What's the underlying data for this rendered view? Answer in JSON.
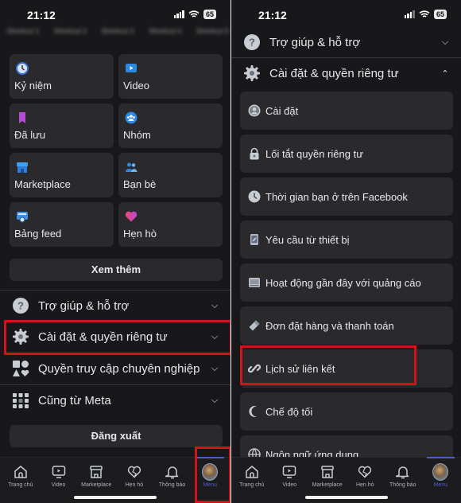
{
  "status_bar": {
    "time": "21:12",
    "battery": "65"
  },
  "left": {
    "blurred_shortcuts": [
      "Shortcut 1",
      "Shortcut 2",
      "Shortcut 3",
      "Shortcut 4",
      "Shortcut 5"
    ],
    "tiles": [
      {
        "label": "Kỷ niệm",
        "icon": "clock-icon"
      },
      {
        "label": "Video",
        "icon": "video-icon"
      },
      {
        "label": "Đã lưu",
        "icon": "bookmark-icon"
      },
      {
        "label": "Nhóm",
        "icon": "groups-icon"
      },
      {
        "label": "Marketplace",
        "icon": "store-icon"
      },
      {
        "label": "Bạn bè",
        "icon": "friends-icon"
      },
      {
        "label": "Bảng feed",
        "icon": "feed-icon"
      },
      {
        "label": "Hẹn hò",
        "icon": "heart-icon"
      }
    ],
    "see_more": "Xem thêm",
    "sections": [
      {
        "label": "Trợ giúp & hỗ trợ",
        "icon": "help-icon",
        "expanded": false
      },
      {
        "label": "Cài đặt & quyền riêng tư",
        "icon": "gear-icon",
        "expanded": false,
        "highlighted": true
      },
      {
        "label": "Quyền truy cập chuyên nghiệp",
        "icon": "shapes-icon",
        "expanded": false
      },
      {
        "label": "Cũng từ Meta",
        "icon": "apps-grid-icon",
        "expanded": false
      }
    ],
    "logout": "Đăng xuất"
  },
  "right": {
    "sections": [
      {
        "label": "Trợ giúp & hỗ trợ",
        "icon": "help-icon",
        "expanded": false
      },
      {
        "label": "Cài đặt & quyền riêng tư",
        "icon": "gear-icon",
        "expanded": true
      }
    ],
    "items": [
      {
        "label": "Cài đặt",
        "icon": "user-circle-icon"
      },
      {
        "label": "Lối tắt quyền riêng tư",
        "icon": "lock-icon"
      },
      {
        "label": "Thời gian bạn ở trên Facebook",
        "icon": "clock-icon"
      },
      {
        "label": "Yêu cầu từ thiết bị",
        "icon": "device-icon"
      },
      {
        "label": "Hoạt động gần đây với quảng cáo",
        "icon": "ad-activity-icon"
      },
      {
        "label": "Đơn đặt hàng và thanh toán",
        "icon": "tag-icon"
      },
      {
        "label": "Lịch sử liên kết",
        "icon": "link-icon",
        "highlighted": true
      },
      {
        "label": "Chế độ tối",
        "icon": "moon-icon"
      },
      {
        "label": "Ngôn ngữ ứng dụng",
        "icon": "globe-icon"
      }
    ]
  },
  "tabbar": [
    {
      "label": "Trang chủ",
      "icon": "home-icon"
    },
    {
      "label": "Video",
      "icon": "video-icon"
    },
    {
      "label": "Marketplace",
      "icon": "store-icon"
    },
    {
      "label": "Hẹn hò",
      "icon": "heart-icon"
    },
    {
      "label": "Thông báo",
      "icon": "bell-icon"
    },
    {
      "label": "Menu",
      "icon": "avatar",
      "active": true
    }
  ],
  "colors": {
    "highlight": "#d4121b",
    "active_tab": "#4a5bd4",
    "background": "#18181a",
    "card": "#2a2a2d"
  }
}
